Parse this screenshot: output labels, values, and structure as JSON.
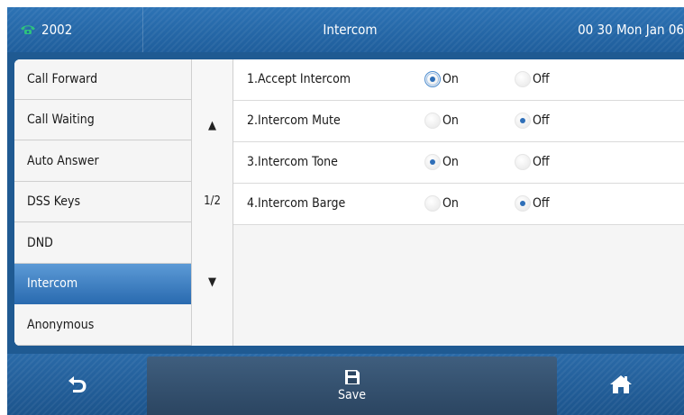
{
  "header": {
    "extension": "2002",
    "title": "Intercom",
    "clock": "00 30 Mon Jan 06",
    "icon": "phone-icon"
  },
  "menu": {
    "items": [
      {
        "label": "Call Forward",
        "active": false
      },
      {
        "label": "Call Waiting",
        "active": false
      },
      {
        "label": "Auto Answer",
        "active": false
      },
      {
        "label": "DSS Keys",
        "active": false
      },
      {
        "label": "DND",
        "active": false
      },
      {
        "label": "Intercom",
        "active": true
      },
      {
        "label": "Anonymous",
        "active": false
      }
    ]
  },
  "scroller": {
    "up_icon": "▲",
    "page_indicator": "1/2",
    "down_icon": "▼"
  },
  "settings": {
    "rows": [
      {
        "label": "1.Accept Intercom",
        "on_label": "On",
        "off_label": "Off",
        "selected": "On",
        "focused": true
      },
      {
        "label": "2.Intercom Mute",
        "on_label": "On",
        "off_label": "Off",
        "selected": "Off",
        "focused": false
      },
      {
        "label": "3.Intercom Tone",
        "on_label": "On",
        "off_label": "Off",
        "selected": "On",
        "focused": false
      },
      {
        "label": "4.Intercom Barge",
        "on_label": "On",
        "off_label": "Off",
        "selected": "Off",
        "focused": false
      }
    ]
  },
  "softkeys": {
    "back_icon": "back-arrow-icon",
    "save_label": "Save",
    "save_icon": "floppy-disk-icon",
    "home_icon": "home-icon"
  },
  "colors": {
    "header_blue": "#2d73b5",
    "active_item": "#2a6bb0",
    "radio_dot": "#2f6fb8",
    "softkey_bar": "#1c548c",
    "phone_icon": "#2ec27e"
  }
}
